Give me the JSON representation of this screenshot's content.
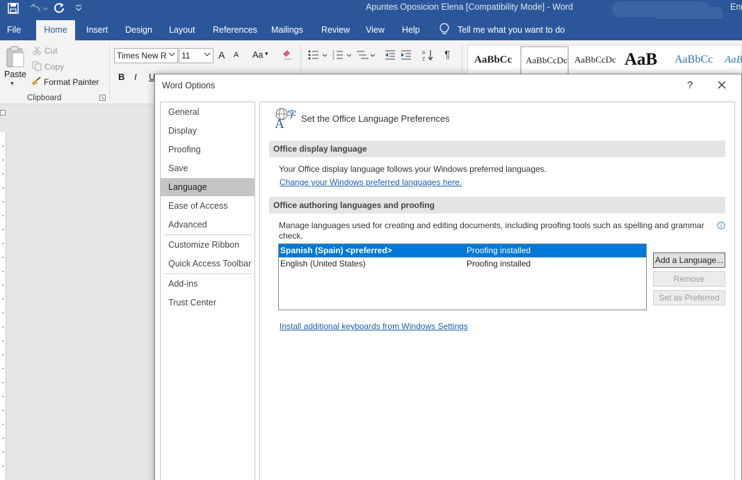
{
  "window": {
    "title": "Apuntes Oposicion Elena  [Compatibility Mode]  -  Word",
    "account": "Enr"
  },
  "ribbon": {
    "tabs": [
      "File",
      "Home",
      "Insert",
      "Design",
      "Layout",
      "References",
      "Mailings",
      "Review",
      "View",
      "Help"
    ],
    "active_tab": "Home",
    "tell_me": "Tell me what you want to do",
    "clipboard": {
      "paste": "Paste",
      "cut": "Cut",
      "copy": "Copy",
      "format_painter": "Format Painter",
      "group_label": "Clipboard"
    },
    "font": {
      "name": "Times New R",
      "size": "11",
      "grow": "A",
      "shrink": "A",
      "case": "Aa",
      "bold": "B",
      "italic": "I",
      "underline": "U"
    },
    "styles": [
      "AaBbCc",
      "AaBbCcDc",
      "AaBbCcDc",
      "AaB",
      "AaBbCc",
      "AaB"
    ]
  },
  "dialog": {
    "title": "Word Options",
    "help": "?",
    "nav": [
      "General",
      "Display",
      "Proofing",
      "Save",
      "Language",
      "Ease of Access",
      "Advanced",
      "Customize Ribbon",
      "Quick Access Toolbar",
      "Add-ins",
      "Trust Center"
    ],
    "selected_nav": "Language",
    "heading": "Set the Office Language Preferences",
    "display_section": {
      "title": "Office display language",
      "text": "Your Office display language follows your Windows preferred languages.",
      "link": "Change your Windows preferred languages here."
    },
    "authoring_section": {
      "title": "Office authoring languages and proofing",
      "text_line1": "Manage languages used for creating and editing documents, including proofing tools such as spelling and grammar",
      "text_line2": "check.",
      "languages": [
        {
          "name": "Spanish (Spain) <preferred>",
          "status": "Proofing installed",
          "selected": true
        },
        {
          "name": "English (United States)",
          "status": "Proofing installed",
          "selected": false
        }
      ],
      "buttons": {
        "add": "Add a Language...",
        "remove": "Remove",
        "set_preferred": "Set as Preferred"
      }
    },
    "keyboards_link": "Install additional keyboards from Windows Settings"
  },
  "colors": {
    "accent": "#2b579a",
    "selection": "#0078d7",
    "link": "#1f5ea8"
  }
}
